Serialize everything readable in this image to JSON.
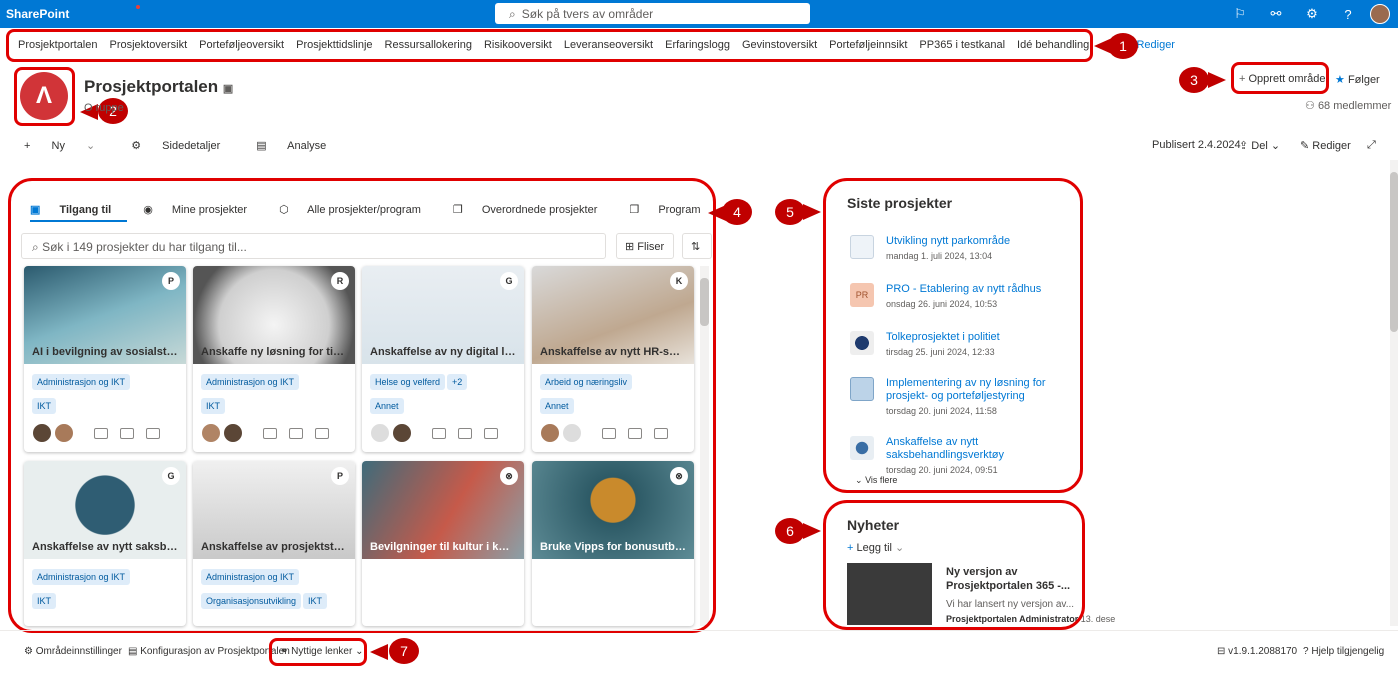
{
  "topbar": {
    "brand": "SharePoint",
    "search_placeholder": "Søk på tvers av områder",
    "icons": [
      "megaphone-icon",
      "network-icon",
      "gear-icon",
      "help-icon",
      "avatar"
    ]
  },
  "hubnav": {
    "items": [
      "Prosjektportalen",
      "Prosjektoversikt",
      "Porteføljeoversikt",
      "Prosjekttidslinje",
      "Ressursallokering",
      "Risikooversikt",
      "Leveranseoversikt",
      "Erfaringslogg",
      "Gevinstoversikt",
      "Porteføljeinnsikt",
      "PP365 i testkanal",
      "Idé behandling"
    ],
    "edit": "Rediger"
  },
  "site": {
    "logo": "Λ",
    "title": "Prosjektportalen",
    "subtitle": "O        ruppe",
    "create": "Opprett område",
    "follow": "Følger",
    "members": "68 medlemmer"
  },
  "cmd": {
    "new": "Ny",
    "details": "Sidedetaljer",
    "analytics": "Analyse",
    "published": "Publisert 2.4.2024",
    "share": "Del",
    "edit": "Rediger"
  },
  "projects": {
    "tabs": [
      "Tilgang til",
      "Mine prosjekter",
      "Alle prosjekter/program",
      "Overordnede prosjekter",
      "Program"
    ],
    "search_placeholder": "Søk i 149 prosjekter du har tilgang til...",
    "filter": "Fliser",
    "cards": [
      {
        "title": "AI i bevilgning av sosialstøtte",
        "badge": "P",
        "tags": [
          "Administrasjon og IKT"
        ],
        "tags2": [
          "IKT"
        ]
      },
      {
        "title": "Anskaffe ny løsning for timeregistrering",
        "badge": "R",
        "tags": [
          "Administrasjon og IKT"
        ],
        "tags2": [
          "IKT"
        ]
      },
      {
        "title": "Anskaffelse av ny digital læringsplattform",
        "badge": "G",
        "tags": [
          "Helse og velferd",
          "+2"
        ],
        "tags2": [
          "Annet"
        ]
      },
      {
        "title": "Anskaffelse av nytt HR-system",
        "badge": "K",
        "tags": [
          "Arbeid og næringsliv"
        ],
        "tags2": [
          "Annet"
        ]
      },
      {
        "title": "Anskaffelse av nytt saksbehandlingssystem",
        "badge": "G",
        "tags": [
          "Administrasjon og IKT"
        ],
        "tags2": [
          "IKT"
        ]
      },
      {
        "title": "Anskaffelse av prosjektstyringsverktøy",
        "badge": "P",
        "tags": [
          "Administrasjon og IKT"
        ],
        "tags2": [
          "Organisasjonsutvikling",
          "IKT"
        ]
      },
      {
        "title": "Bevilgninger til kultur i kommunen",
        "badge": "⊗",
        "tags": [],
        "tags2": []
      },
      {
        "title": "Bruke Vipps for bonusutbetaling",
        "badge": "⊗",
        "tags": [],
        "tags2": []
      }
    ]
  },
  "recent": {
    "title": "Siste prosjekter",
    "items": [
      {
        "name": "Utvikling nytt parkområde",
        "date": "mandag 1. juli 2024, 13:04",
        "icon": "PR"
      },
      {
        "name": "PRO - Etablering av nytt rådhus",
        "date": "onsdag 26. juni 2024, 10:53",
        "icon": "PR"
      },
      {
        "name": "Tolkeprosjektet i politiet",
        "date": "tirsdag 25. juni 2024, 12:33",
        "icon": ""
      },
      {
        "name": "Implementering av ny løsning for prosjekt- og porteføljestyring",
        "date": "torsdag 20. juni 2024, 11:58",
        "icon": ""
      },
      {
        "name": "Anskaffelse av nytt saksbehandlingsverktøy",
        "date": "torsdag 20. juni 2024, 09:51",
        "icon": ""
      }
    ],
    "more": "Vis flere"
  },
  "news": {
    "title": "Nyheter",
    "add": "Legg til",
    "headline": "Ny versjon av Prosjektportalen 365 -...",
    "teaser": "Vi har lansert ny versjon av...",
    "author": "Prosjektportalen Administrator",
    "date": "13. dese"
  },
  "footer": {
    "settings": "Områdeinnstillinger",
    "config": "Konfigurasjon av Prosjektportalen",
    "links": "Nyttige lenker",
    "version": "v1.9.1.2088170",
    "help": "Hjelp tilgjengelig"
  },
  "callouts": [
    "1",
    "2",
    "3",
    "4",
    "5",
    "6",
    "7"
  ],
  "colors": {
    "accent": "#0078d4",
    "callout": "#c00000"
  }
}
